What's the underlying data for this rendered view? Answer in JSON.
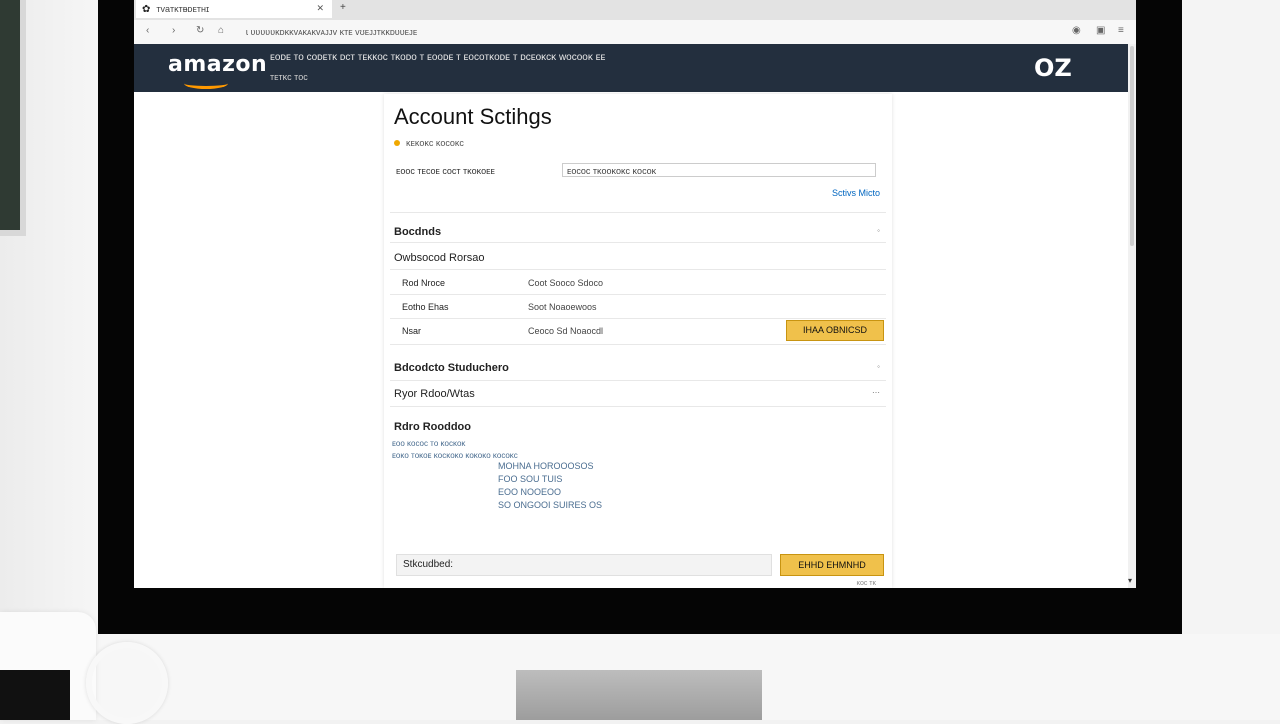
{
  "browser": {
    "tab_title": "ᴛvaᴛᴋᴛᴃᴅᴇᴛʜɪ",
    "address": "ɩ ʋʋʋʋʋᴋᴅᴋᴋᴠᴀᴋᴀᴋᴠᴀᴊᴊᴠ ᴋᴛᴇ ᴠʊᴇᴊᴊᴛᴋᴋᴅᴜᴜᴇᴊᴇ",
    "icons": [
      "back-icon",
      "forward-icon",
      "reload-icon",
      "home-icon",
      "profile-icon",
      "extension-icon",
      "menu-icon"
    ]
  },
  "header": {
    "logo": "amazon",
    "nav_text": "ᴇᴏᴅᴇ ᴛᴏ ᴄᴏᴅᴇᴛᴋ ᴅᴄᴛ ᴛᴇᴋᴋᴏᴄ ᴛᴋᴏᴅᴏ ᴛ ᴇᴏᴏᴅᴇ ᴛ ᴇᴏᴄᴏᴛᴋᴏᴅᴇ ᴛ ᴅᴄᴇᴏᴋᴄᴋ ᴡᴏᴄᴏᴏᴋ ᴇᴇ",
    "sub_text": "ᴛᴇᴛᴋᴄ ᴛᴏᴄ",
    "right_mark": "OZ",
    "accent": "#ff9900",
    "bg": "#232f3e"
  },
  "page": {
    "title": "Account Sctihgs",
    "crumb": "ᴋᴇᴋᴏᴋᴄ      ᴋᴏᴄᴏᴋᴄ",
    "search_label": "ᴇᴏᴏᴄ  ᴛᴇᴄᴏᴇ ᴄᴏᴄᴛ ᴛᴋᴏᴋᴏᴇᴇ",
    "search_value": "ᴇᴏᴄᴏᴄ ᴛᴋᴏᴏᴋᴏᴋᴄ ᴋᴏᴄᴏᴋ",
    "link_right": "Sctivs Micto",
    "sections": {
      "s1_heading": "Bocdnds",
      "s1_sub": "Owbsocod Rorsao",
      "rows": [
        {
          "label": "Rod Nroce",
          "value": "Coot Sooco Sdoco"
        },
        {
          "label": "Eotho Ehas",
          "value": "Soot Noaoewoos"
        },
        {
          "label": "Nsar",
          "value": "Ceoco  Sd Noaocdl"
        }
      ],
      "row_button": "IHAA OBNICSD",
      "s2_heading": "Bdcodcto Studuchero",
      "s2_sub": "Ryor Rdoo/Wtas",
      "s3_heading": "Rdro Rooddoo",
      "info_lines": [
        "ᴇᴏᴏ ᴋᴏᴄᴏᴄ ᴛᴏ ᴋᴏᴄᴋᴏᴋ",
        "ᴇᴏᴋᴏ ᴛᴏᴋᴏᴇ ᴋᴏᴄᴋᴏᴋᴏ ᴋᴏᴋᴏᴋᴏ ᴋᴏᴄᴏᴋᴄ"
      ],
      "info_block": [
        "MOHNA HOROOOSOS",
        "FOO SOU TUIS",
        "EOO NOOEOO",
        "SO ONGOOI SUIRES OS"
      ]
    },
    "sub_field_label": "Stkcudbed:",
    "sub_button": "EHHD EHMNHD",
    "footnote": "ᴋᴏᴄ ᴛᴋ"
  }
}
